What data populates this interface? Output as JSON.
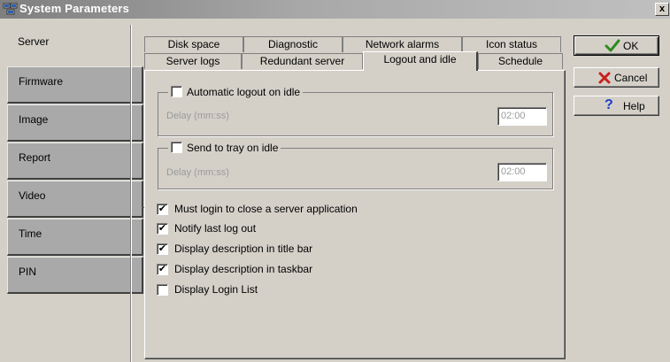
{
  "window": {
    "title": "System Parameters",
    "close_glyph": "x"
  },
  "sidebar": {
    "items": [
      {
        "label": "Server",
        "active": true
      },
      {
        "label": "Firmware",
        "active": false
      },
      {
        "label": "Image",
        "active": false
      },
      {
        "label": "Report",
        "active": false
      },
      {
        "label": "Video",
        "active": false
      },
      {
        "label": "Time",
        "active": false
      },
      {
        "label": "PIN",
        "active": false
      }
    ]
  },
  "tabs": {
    "row1": [
      "Disk space",
      "Diagnostic",
      "Network alarms",
      "Icon status"
    ],
    "row2": [
      "Server logs",
      "Redundant server",
      "Logout and idle",
      "Schedule"
    ],
    "active": "Logout and idle"
  },
  "logout_group": {
    "label": "Automatic logout on idle",
    "checked": false,
    "delay_label": "Delay (mm:ss)",
    "delay_value": "02:00"
  },
  "tray_group": {
    "label": "Send to tray on idle",
    "checked": false,
    "delay_label": "Delay (mm:ss)",
    "delay_value": "02:00"
  },
  "options": [
    {
      "label": "Must login to close a server application",
      "checked": true
    },
    {
      "label": "Notify last log out",
      "checked": true
    },
    {
      "label": "Display description in title bar",
      "checked": true
    },
    {
      "label": "Display description in taskbar",
      "checked": true
    },
    {
      "label": "Display Login List",
      "checked": false
    }
  ],
  "buttons": {
    "ok": {
      "label": "OK",
      "icon": "checkmark-icon",
      "color": "#2e8b1e"
    },
    "cancel": {
      "label": "Cancel",
      "icon": "x-icon",
      "color": "#c8201c"
    },
    "help": {
      "label": "Help",
      "icon": "question-icon",
      "color": "#1c3cc8"
    }
  },
  "check_glyph": "✔"
}
